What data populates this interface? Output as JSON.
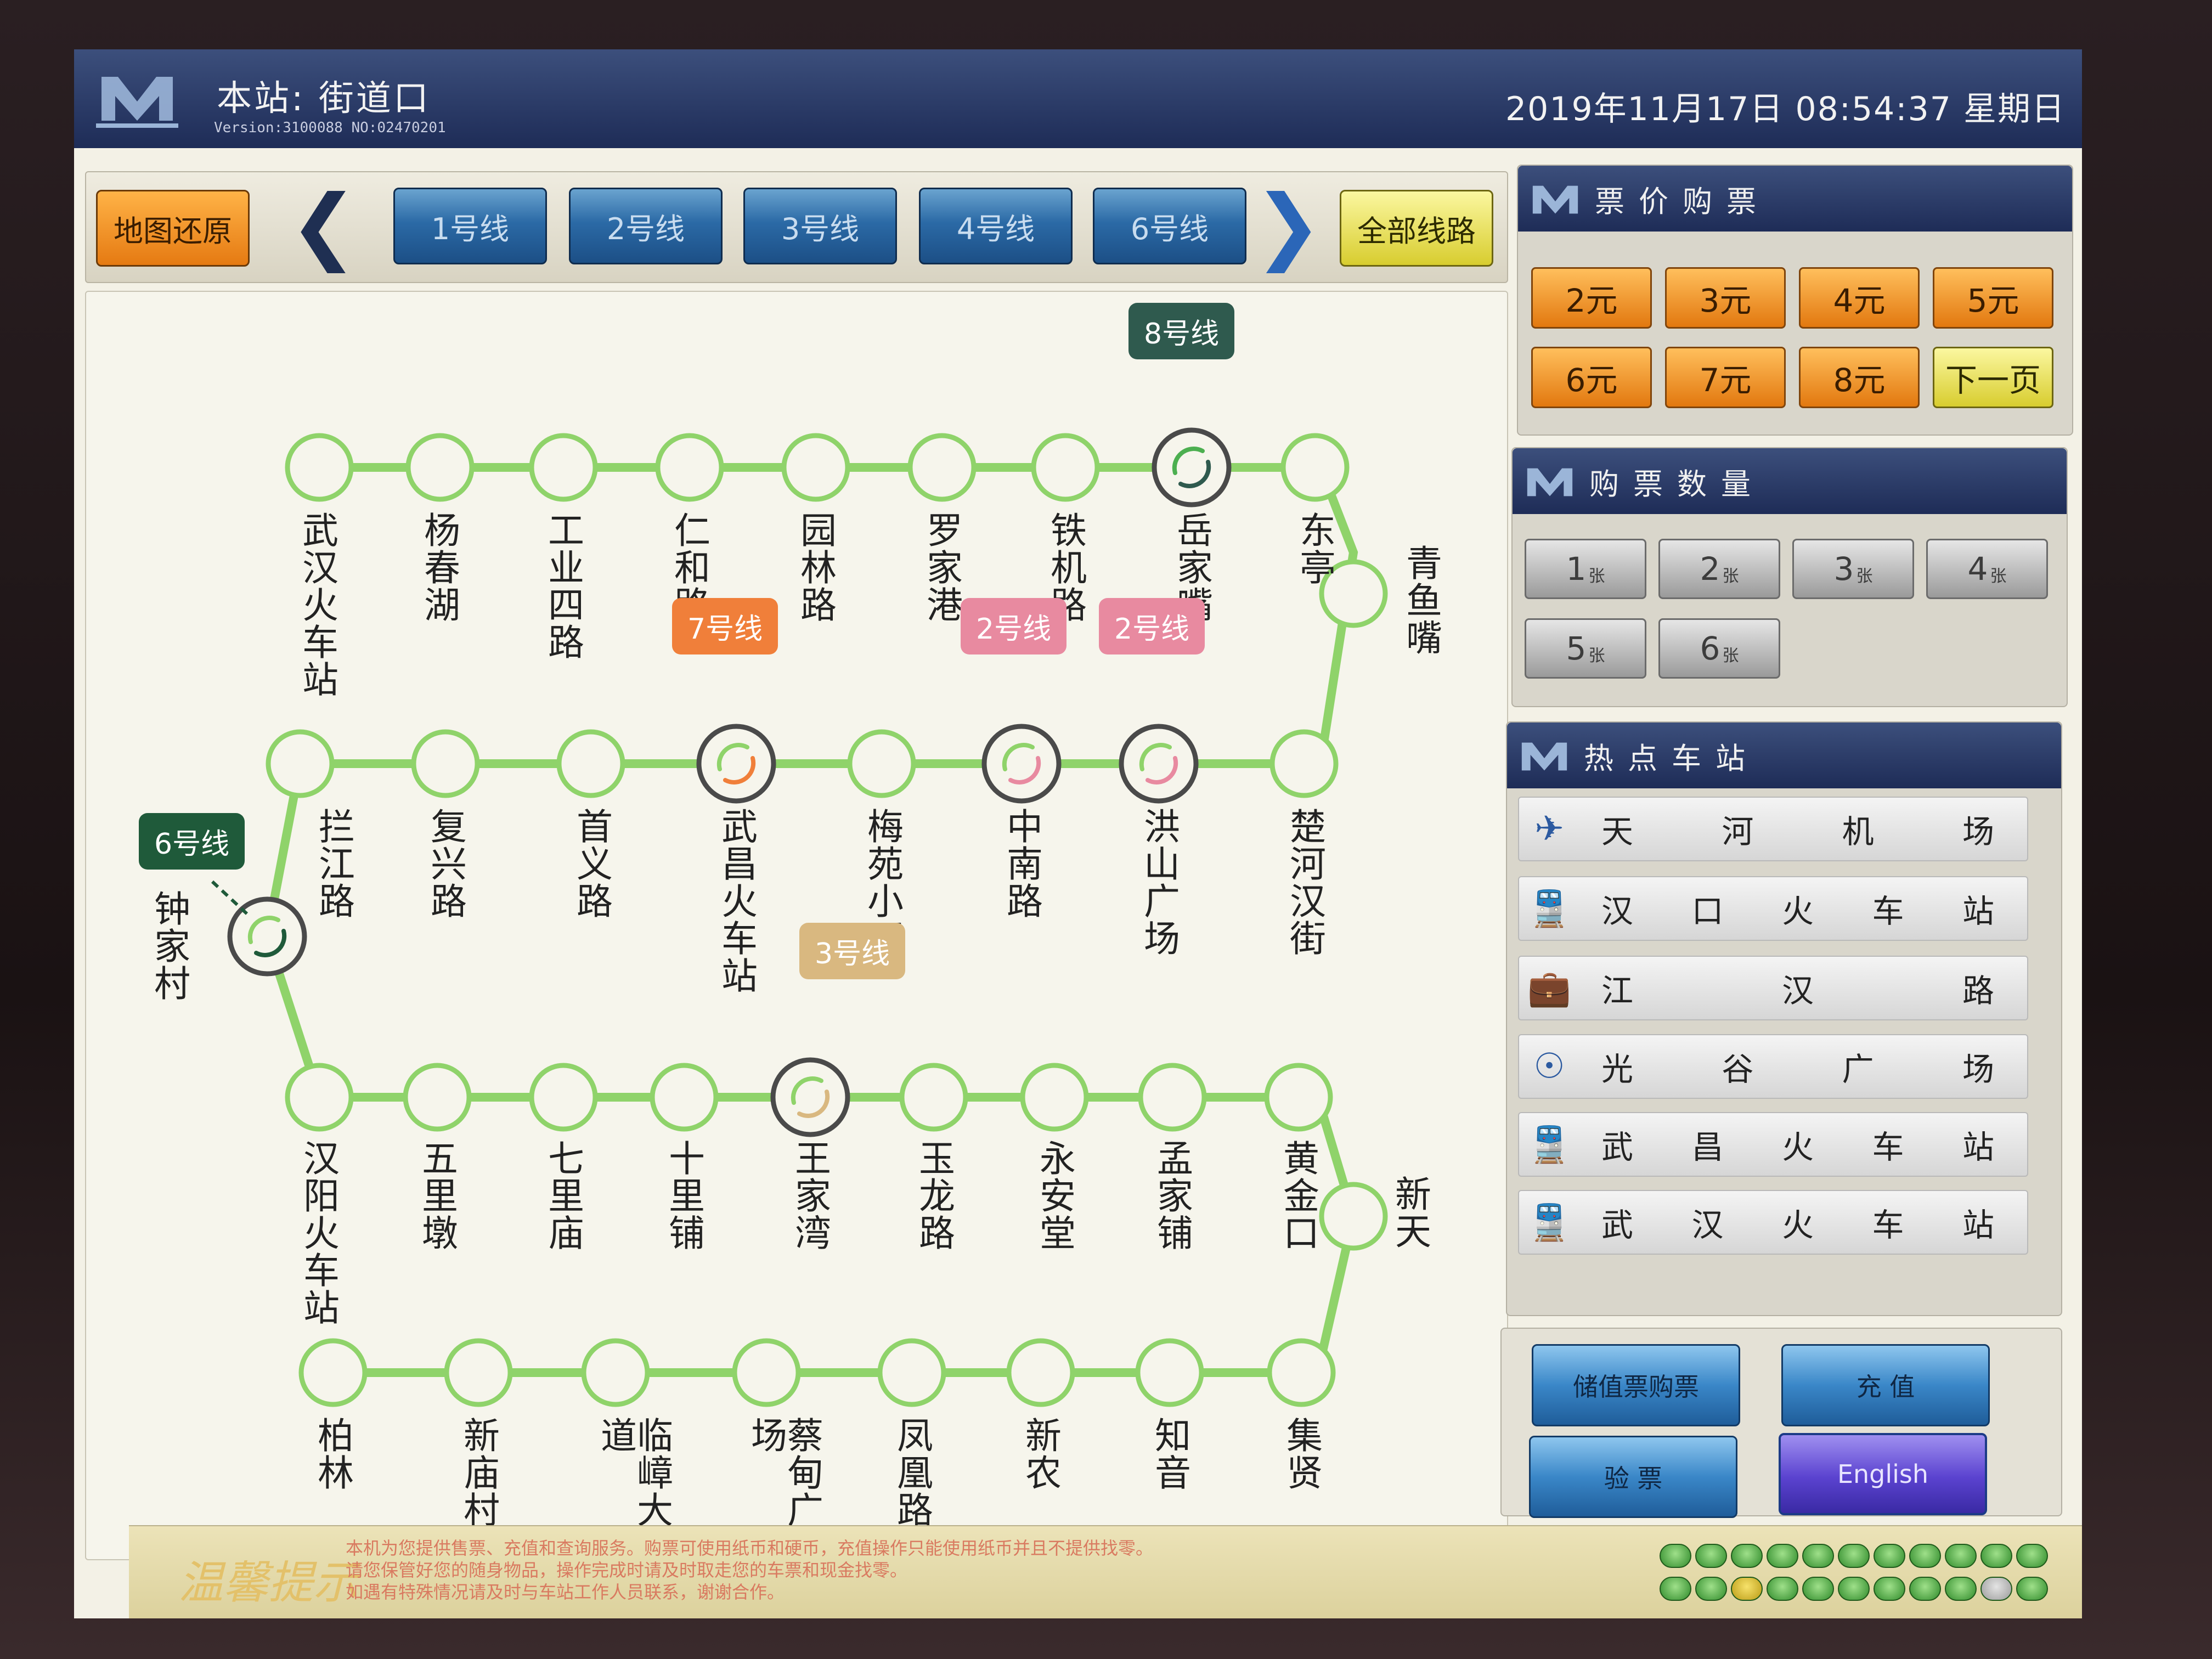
{
  "header": {
    "station_label": "本站: 街道口",
    "version_text": "Version:3100088   NO:02470201",
    "datetime": "2019年11月17日  08:54:37  星期日"
  },
  "toolbar": {
    "reset_map": "地图还原",
    "lines": [
      "1号线",
      "2号线",
      "3号线",
      "4号线",
      "6号线"
    ],
    "all_lines": "全部线路"
  },
  "map": {
    "row1": [
      "武汉火车站",
      "杨春湖",
      "工业四路",
      "仁和路",
      "园林路",
      "罗家港",
      "铁机路",
      "岳家嘴",
      "东亭"
    ],
    "right_top": "青鱼嘴",
    "row2": [
      "拦江路",
      "复兴路",
      "首义路",
      "武昌火车站",
      "梅苑小区",
      "中南路",
      "洪山广场",
      "楚河汉街"
    ],
    "left_mid": "钟家村",
    "row3": [
      "汉阳火车站",
      "五里墩",
      "七里庙",
      "十里铺",
      "王家湾",
      "玉龙路",
      "永安堂",
      "孟家铺",
      "黄金口"
    ],
    "right_bottom": "新天",
    "row4": [
      "柏林",
      "新庙村",
      "临嶂大道",
      "蔡甸广场",
      "凤凰路",
      "新农",
      "知音",
      "集贤"
    ],
    "transfers": {
      "line8": "8号线",
      "line7": "7号线",
      "line2a": "2号线",
      "line2b": "2号线",
      "line6": "6号线",
      "line3": "3号线"
    },
    "colors": {
      "line": "#8fd36a",
      "line8": "#2f5a4e",
      "line7": "#f07f3a",
      "line2": "#e88aa0",
      "line6": "#1f5a3a",
      "line3": "#d9b880"
    }
  },
  "fare": {
    "title": "票价购票",
    "prices": [
      "2元",
      "3元",
      "4元",
      "5元",
      "6元",
      "7元",
      "8元"
    ],
    "next_page": "下一页"
  },
  "quantity": {
    "title": "购票数量",
    "counts": [
      "1",
      "2",
      "3",
      "4",
      "5",
      "6"
    ],
    "unit": "张"
  },
  "hot": {
    "title": "热点车站",
    "stations": [
      {
        "icon": "airplane-icon",
        "chars": [
          "天",
          "河",
          "机",
          "场"
        ]
      },
      {
        "icon": "train-icon",
        "chars": [
          "汉",
          "口",
          "火",
          "车",
          "站"
        ]
      },
      {
        "icon": "briefcase-icon",
        "chars": [
          "江",
          "汉",
          "路"
        ]
      },
      {
        "icon": "satellite-icon",
        "chars": [
          "光",
          "谷",
          "广",
          "场"
        ]
      },
      {
        "icon": "train-icon",
        "chars": [
          "武",
          "昌",
          "火",
          "车",
          "站"
        ]
      },
      {
        "icon": "train-icon",
        "chars": [
          "武",
          "汉",
          "火",
          "车",
          "站"
        ]
      }
    ]
  },
  "functions": {
    "stored_value": "储值票购票",
    "recharge": "充  值",
    "verify": "验  票",
    "english": "English"
  },
  "footer": {
    "tip_title": "温馨提示",
    "tip_lines": [
      "本机为您提供售票、充值和查询服务。购票可使用纸币和硬币，充值操作只能使用纸币并且不提供找零。",
      "请您保管好您的随身物品，操作完成时请及时取走您的车票和现金找零。",
      "如遇有特殊情况请及时与车站工作人员联系，谢谢合作。"
    ]
  }
}
